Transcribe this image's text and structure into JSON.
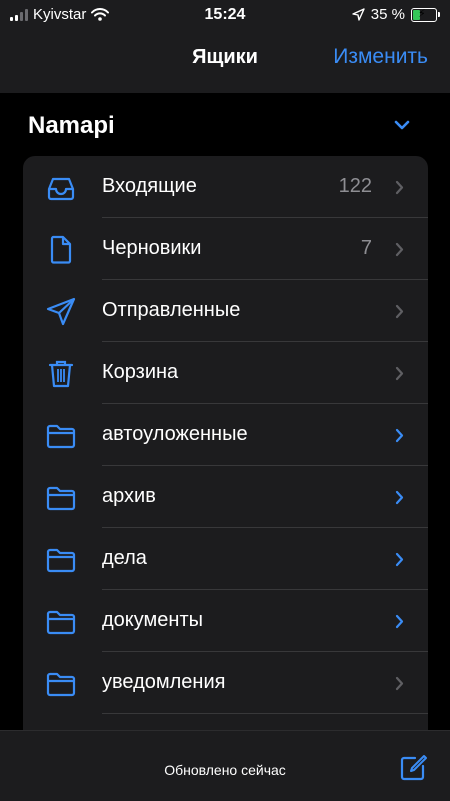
{
  "status_bar": {
    "carrier": "Kyivstar",
    "time": "15:24",
    "battery_percent": "35 %",
    "battery_level": 0.35
  },
  "nav": {
    "title": "Ящики",
    "edit_label": "Изменить"
  },
  "account": {
    "name": "Namapi"
  },
  "mailboxes": [
    {
      "label": "Входящие",
      "count": "122",
      "icon": "inbox-tray-icon"
    },
    {
      "label": "Черновики",
      "count": "7",
      "icon": "document-icon"
    },
    {
      "label": "Отправленные",
      "count": "",
      "icon": "paper-plane-icon"
    },
    {
      "label": "Корзина",
      "count": "",
      "icon": "trash-icon"
    },
    {
      "label": "автоуложенные",
      "count": "",
      "icon": "folder-icon"
    },
    {
      "label": "архив",
      "count": "",
      "icon": "folder-icon"
    },
    {
      "label": "дела",
      "count": "",
      "icon": "folder-icon"
    },
    {
      "label": "документы",
      "count": "",
      "icon": "folder-icon"
    },
    {
      "label": "уведомления",
      "count": "",
      "icon": "folder-icon"
    }
  ],
  "footer": {
    "updated_text": "Обновлено сейчас"
  },
  "colors": {
    "accent": "#3a8cf5",
    "background": "#000000",
    "card": "#1c1c1e",
    "secondary_text": "#8e8e93",
    "battery_fill": "#34c759"
  }
}
